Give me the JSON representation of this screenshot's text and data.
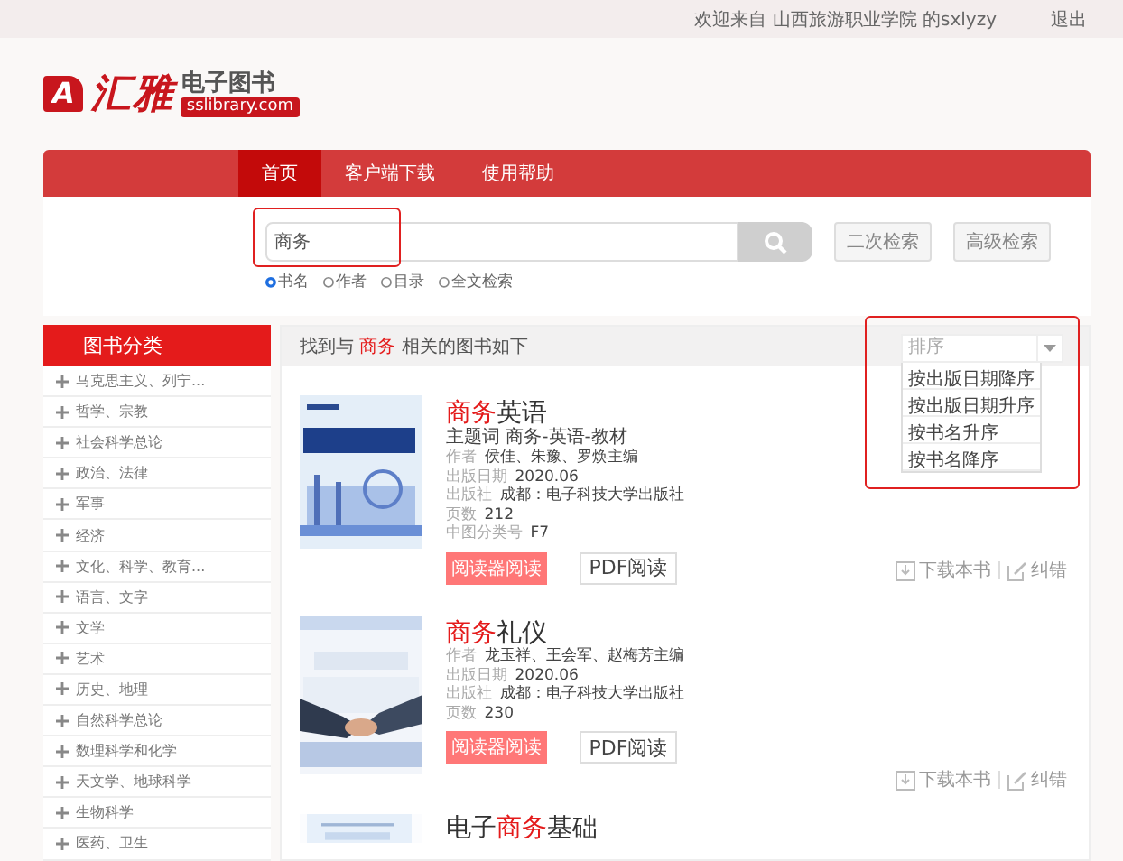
{
  "top_bar": {
    "welcome": "欢迎来自 山西旅游职业学院 的sxlyzy",
    "logout": "退出"
  },
  "logo": {
    "mark": "A",
    "name": "汇雅",
    "title": "电子图书",
    "domain": "sslibrary.com"
  },
  "nav": [
    {
      "label": "首页",
      "selected": true
    },
    {
      "label": "客户端下载",
      "selected": false
    },
    {
      "label": "使用帮助",
      "selected": false
    }
  ],
  "search": {
    "value": "商务",
    "buttons": [
      "二次检索",
      "高级检索"
    ],
    "highlighted": true,
    "scopes": [
      {
        "label": "书名",
        "selected": true
      },
      {
        "label": "作者",
        "selected": false
      },
      {
        "label": "目录",
        "selected": false
      },
      {
        "label": "全文检索",
        "selected": false
      }
    ]
  },
  "sidebar": {
    "title": "图书分类",
    "items": [
      "马克思主义、列宁...",
      "哲学、宗教",
      "社会科学总论",
      "政治、法律",
      "军事",
      "经济",
      "文化、科学、教育...",
      "语言、文字",
      "文学",
      "艺术",
      "历史、地理",
      "自然科学总论",
      "数理科学和化学",
      "天文学、地球科学",
      "生物科学",
      "医药、卫生"
    ]
  },
  "results": {
    "summary": [
      {
        "text": "找到与 ",
        "highlight": false
      },
      {
        "text": "商务",
        "highlight": true
      },
      {
        "text": " 相关的图书如下",
        "highlight": false
      }
    ],
    "sort": {
      "placeholder": "排序",
      "expanded": true,
      "highlighted": true,
      "options": [
        "按出版日期降序",
        "按出版日期升序",
        "按书名升序",
        "按书名降序"
      ]
    },
    "books": [
      {
        "title": [
          {
            "text": "商务",
            "highlight": true
          },
          {
            "text": "英语",
            "highlight": false
          }
        ],
        "subject": "主题词 商务-英语-教材",
        "meta": [
          {
            "label": "作者",
            "value": "侯佳、朱豫、罗焕主编"
          },
          {
            "label": "出版日期",
            "value": "2020.06"
          },
          {
            "label": "出版社",
            "value": "成都：电子科技大学出版社"
          },
          {
            "label": "页数",
            "value": "212"
          },
          {
            "label": "中图分类号",
            "value": "F7"
          }
        ],
        "buttons": [
          "阅读器阅读",
          "PDF阅读"
        ],
        "actions": [
          "下载本书",
          "纠错"
        ]
      },
      {
        "title": [
          {
            "text": "商务",
            "highlight": true
          },
          {
            "text": "礼仪",
            "highlight": false
          }
        ],
        "meta": [
          {
            "label": "作者",
            "value": "龙玉祥、王会军、赵梅芳主编"
          },
          {
            "label": "出版日期",
            "value": "2020.06"
          },
          {
            "label": "出版社",
            "value": "成都：电子科技大学出版社"
          },
          {
            "label": "页数",
            "value": "230"
          }
        ],
        "buttons": [
          "阅读器阅读",
          "PDF阅读"
        ],
        "actions": [
          "下载本书",
          "纠错"
        ]
      },
      {
        "title": [
          {
            "text": "电子",
            "highlight": false
          },
          {
            "text": "商务",
            "highlight": true
          },
          {
            "text": "基础",
            "highlight": false
          }
        ]
      }
    ]
  }
}
